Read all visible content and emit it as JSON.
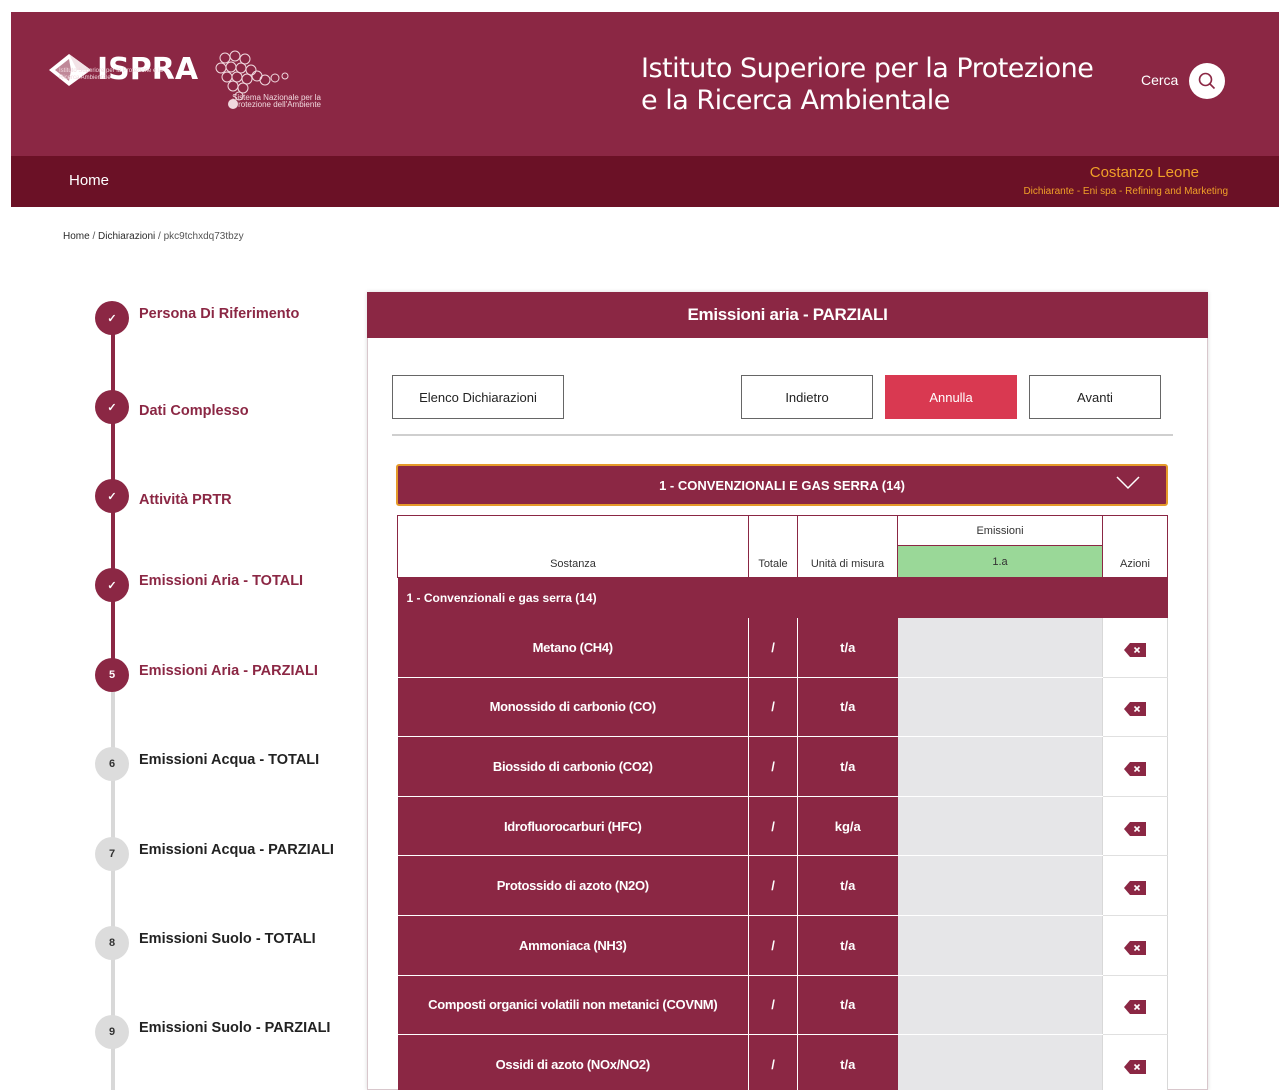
{
  "header": {
    "logo_text": "ISPRA",
    "logo_subtitle": "Istituto Superiore per la Protezione e la Ricerca Ambientale",
    "snpa_text": "Sistema Nazionale per la Protezione dell'Ambiente",
    "site_title_line1": "Istituto Superiore per la Protezione",
    "site_title_line2": "e la Ricerca Ambientale",
    "search_label": "Cerca",
    "brand_color": "#8b2744"
  },
  "navbar": {
    "home_label": "Home",
    "user_name": "Costanzo Leone",
    "user_role": "Dichiarante - Eni spa - Refining and Marketing"
  },
  "breadcrumb": {
    "home": "Home",
    "sep1": " / ",
    "dichiarazioni": "Dichiarazioni",
    "sep2": " / ",
    "current": "pkc9tchxdq73tbzy"
  },
  "stepper": [
    {
      "marker": "✓",
      "label": "Persona Di Riferimento",
      "state": "done"
    },
    {
      "marker": "✓",
      "label": "Dati Complesso",
      "state": "done"
    },
    {
      "marker": "✓",
      "label": "Attività PRTR",
      "state": "done"
    },
    {
      "marker": "✓",
      "label": "Emissioni Aria - TOTALI",
      "state": "done"
    },
    {
      "marker": "5",
      "label": "Emissioni Aria - PARZIALI",
      "state": "active"
    },
    {
      "marker": "6",
      "label": "Emissioni Acqua - TOTALI",
      "state": "todo"
    },
    {
      "marker": "7",
      "label": "Emissioni Acqua - PARZIALI",
      "state": "todo"
    },
    {
      "marker": "8",
      "label": "Emissioni Suolo - TOTALI",
      "state": "todo"
    },
    {
      "marker": "9",
      "label": "Emissioni Suolo - PARZIALI",
      "state": "todo"
    }
  ],
  "panel": {
    "title": "Emissioni aria - PARZIALI",
    "buttons": {
      "elenco": "Elenco Dichiarazioni",
      "indietro": "Indietro",
      "annulla": "Annulla",
      "avanti": "Avanti"
    },
    "accordion_title": "1 - CONVENZIONALI E GAS SERRA (14)"
  },
  "table": {
    "headers": {
      "sostanza": "Sostanza",
      "totale": "Totale",
      "unita": "Unità di misura",
      "emissioni": "Emissioni",
      "emissioni_sub": "1.a",
      "azioni": "Azioni"
    },
    "group_label": "1 - Convenzionali e gas serra (14)",
    "rows": [
      {
        "name": "Metano (CH4)",
        "total": "/",
        "unit": "t/a"
      },
      {
        "name": "Monossido di carbonio (CO)",
        "total": "/",
        "unit": "t/a"
      },
      {
        "name": "Biossido di carbonio (CO2)",
        "total": "/",
        "unit": "t/a"
      },
      {
        "name": "Idrofluorocarburi (HFC)",
        "total": "/",
        "unit": "kg/a"
      },
      {
        "name": "Protossido di azoto (N2O)",
        "total": "/",
        "unit": "t/a"
      },
      {
        "name": "Ammoniaca (NH3)",
        "total": "/",
        "unit": "t/a"
      },
      {
        "name": "Composti organici volatili non metanici (COVNM)",
        "total": "/",
        "unit": "t/a"
      },
      {
        "name": "Ossidi di azoto (NOx/NO2)",
        "total": "/",
        "unit": "t/a"
      }
    ]
  }
}
